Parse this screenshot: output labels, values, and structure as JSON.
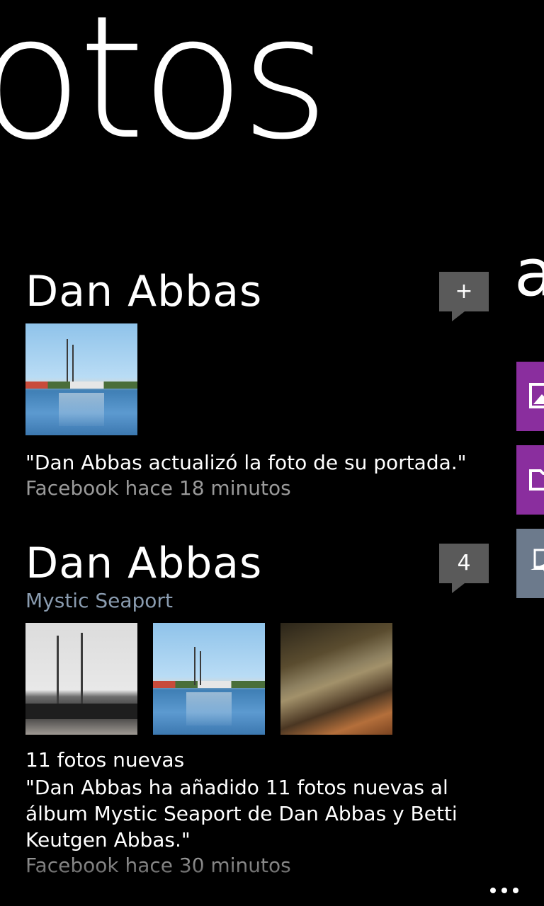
{
  "hub": {
    "title": "otos",
    "next_section_title": "a"
  },
  "feed": [
    {
      "author": "Dan Abbas",
      "badge": "+",
      "caption": "\"Dan Abbas actualizó la foto de su portada.\"",
      "source": "Facebook hace 18 minutos"
    },
    {
      "author": "Dan Abbas",
      "album": "Mystic Seaport",
      "badge": "4",
      "new_count": "11 fotos nuevas",
      "caption": "\"Dan Abbas ha añadido 11 fotos nuevas al álbum Mystic Seaport de Dan Abbas y Betti Keutgen Abbas.\"",
      "source": "Facebook hace 30 minutos"
    }
  ],
  "tiles": [
    {
      "icon": "picture-icon",
      "color": "#8a2e9e"
    },
    {
      "icon": "folder-icon",
      "color": "#8a2e9e"
    },
    {
      "icon": "share-send-icon",
      "color": "#6c7a8c"
    }
  ],
  "colors": {
    "background": "#000000",
    "accent_purple": "#8a2e9e",
    "link_blue_gray": "#8a9cb0",
    "secondary_text": "#9a9a9a",
    "badge": "#5a5a5a"
  }
}
